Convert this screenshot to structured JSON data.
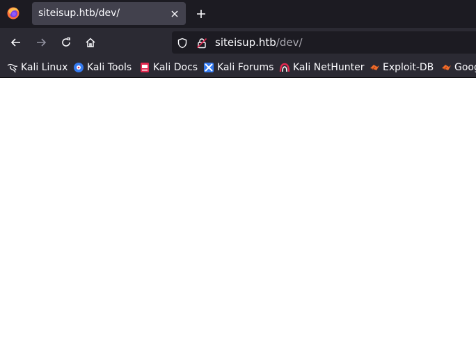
{
  "tab": {
    "title": "siteisup.htb/dev/"
  },
  "url": {
    "host": "siteisup.htb",
    "path": "/dev/"
  },
  "bookmarks": [
    {
      "label": "Kali Linux",
      "icon": "kali-dragon-icon"
    },
    {
      "label": "Kali Tools",
      "icon": "kali-tools-icon"
    },
    {
      "label": "Kali Docs",
      "icon": "kali-docs-icon"
    },
    {
      "label": "Kali Forums",
      "icon": "kali-forums-icon"
    },
    {
      "label": "Kali NetHunter",
      "icon": "kali-nethunter-icon"
    },
    {
      "label": "Exploit-DB",
      "icon": "exploit-db-icon"
    },
    {
      "label": "Google Hacking DB",
      "icon": "ghdb-icon"
    }
  ],
  "colors": {
    "tabbar": "#1c1b22",
    "toolbar": "#2b2a33",
    "active_tab": "#42414d",
    "text": "#fbfbfe",
    "page": "#ffffff"
  }
}
